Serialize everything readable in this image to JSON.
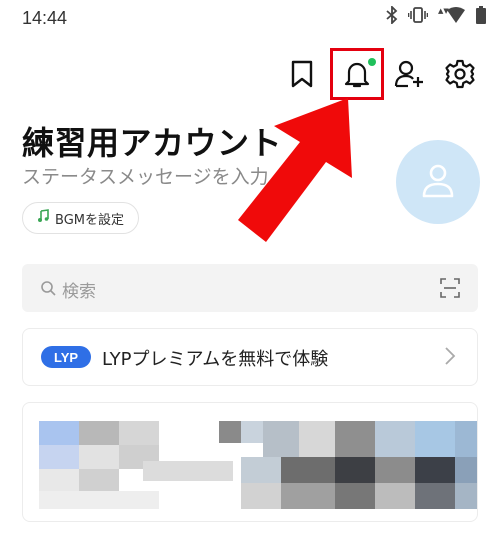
{
  "status_bar": {
    "time": "14:44",
    "icons": [
      "bluetooth-icon",
      "vibrate-icon",
      "wifi-icon",
      "battery-icon"
    ]
  },
  "header": {
    "icons": [
      "bookmark-icon",
      "bell-icon",
      "add-friend-icon",
      "gear-icon"
    ],
    "notification_dot_color": "#20c05b",
    "highlight_color": "#e4000f"
  },
  "profile": {
    "name": "練習用アカウント",
    "status_message": "ステータスメッセージを入力",
    "bgm_label": "BGMを設定",
    "avatar_color": "#cfe6f7"
  },
  "search": {
    "placeholder": "検索"
  },
  "premium": {
    "badge": "LYP",
    "text": "LYPプレミアムを無料で体験",
    "badge_color": "#2f6fe6"
  },
  "annotation": {
    "arrow_color": "#f00a0a"
  }
}
